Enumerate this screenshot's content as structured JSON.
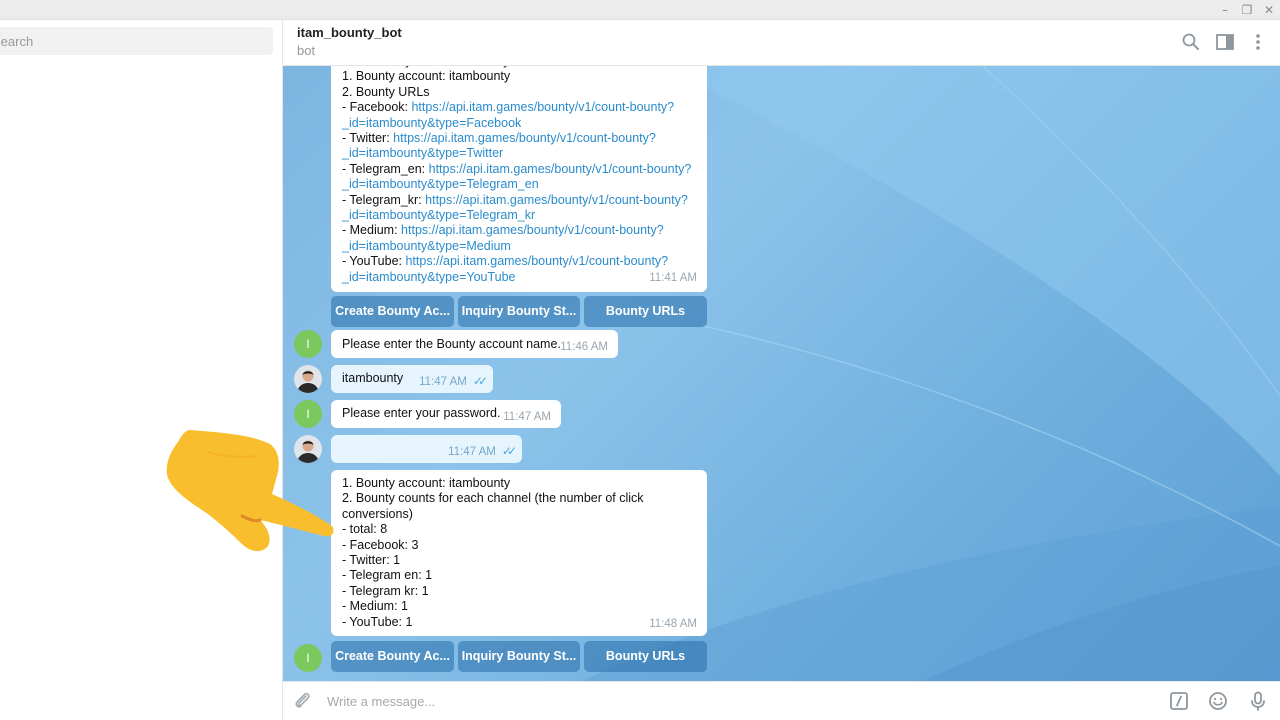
{
  "window": {
    "controls": {
      "minimize": "–",
      "restore": "❐",
      "close": "✕"
    }
  },
  "sidebar": {
    "search": {
      "placeholder": "Search"
    }
  },
  "header": {
    "title": "itam_bounty_bot",
    "status": "bot",
    "icons": [
      "search-icon",
      "sidebar-toggle-icon",
      "more-vert-icon"
    ]
  },
  "messages": {
    "urls_message": {
      "lines": [
        [
          {
            "t": "Successfully created a Bounty account."
          }
        ],
        [
          {
            "t": "1. Bounty account: itambounty"
          }
        ],
        [
          {
            "t": "2. Bounty URLs"
          }
        ],
        [
          {
            "t": "- Facebook: "
          },
          {
            "t": "https://api.itam.games/bounty/v1/count-bounty?",
            "link": true
          }
        ],
        [
          {
            "t": "_id=itambounty&type=Facebook",
            "link": true
          }
        ],
        [
          {
            "t": "- Twitter: "
          },
          {
            "t": "https://api.itam.games/bounty/v1/count-bounty?",
            "link": true
          }
        ],
        [
          {
            "t": "_id=itambounty&type=Twitter",
            "link": true
          }
        ],
        [
          {
            "t": "- Telegram_en: "
          },
          {
            "t": "https://api.itam.games/bounty/v1/count-bounty?",
            "link": true
          }
        ],
        [
          {
            "t": "_id=itambounty&type=Telegram_en",
            "link": true
          }
        ],
        [
          {
            "t": "- Telegram_kr: "
          },
          {
            "t": "https://api.itam.games/bounty/v1/count-bounty?",
            "link": true
          }
        ],
        [
          {
            "t": "_id=itambounty&type=Telegram_kr",
            "link": true
          }
        ],
        [
          {
            "t": "- Medium: "
          },
          {
            "t": "https://api.itam.games/bounty/v1/count-bounty?",
            "link": true
          }
        ],
        [
          {
            "t": "_id=itambounty&type=Medium",
            "link": true
          }
        ],
        [
          {
            "t": "- YouTube: "
          },
          {
            "t": "https://api.itam.games/bounty/v1/count-bounty?",
            "link": true
          }
        ],
        [
          {
            "t": "_id=itambounty&type=YouTube",
            "link": true
          }
        ]
      ],
      "time": "11:41 AM"
    },
    "keyboard_1": [
      "Create Bounty Ac...",
      "Inquiry Bounty St...",
      "Bounty URLs"
    ],
    "enter_name": {
      "avatar": "I",
      "text": "Please enter the Bounty account name.",
      "time": "11:46 AM"
    },
    "user_name": {
      "text": "itambounty",
      "time": "11:47 AM"
    },
    "enter_password": {
      "avatar": "I",
      "text": "Please enter your password.",
      "time": "11:47 AM"
    },
    "user_password": {
      "text": "",
      "time": "11:47 AM"
    },
    "counts_message": {
      "lines": [
        "1. Bounty account: itambounty",
        "2. Bounty counts for each channel (the number of click",
        "conversions)",
        "- total: 8",
        "- Facebook: 3",
        "- Twitter: 1",
        "- Telegram en: 1",
        "- Telegram kr: 1",
        "- Medium: 1",
        "- YouTube: 1"
      ],
      "time": "11:48 AM"
    },
    "keyboard_2": {
      "avatar": "I",
      "buttons": [
        "Create Bounty Ac...",
        "Inquiry Bounty St...",
        "Bounty URLs"
      ]
    }
  },
  "composer": {
    "placeholder": "Write a message...",
    "icons": [
      "attach-icon",
      "bot-command-icon",
      "emoji-icon",
      "microphone-icon"
    ]
  },
  "colors": {
    "accent": "#2a8bcc",
    "bot_avatar": "#7bc85f",
    "keyboard_button": "#4e88b8",
    "hand": "#f9be2e"
  }
}
